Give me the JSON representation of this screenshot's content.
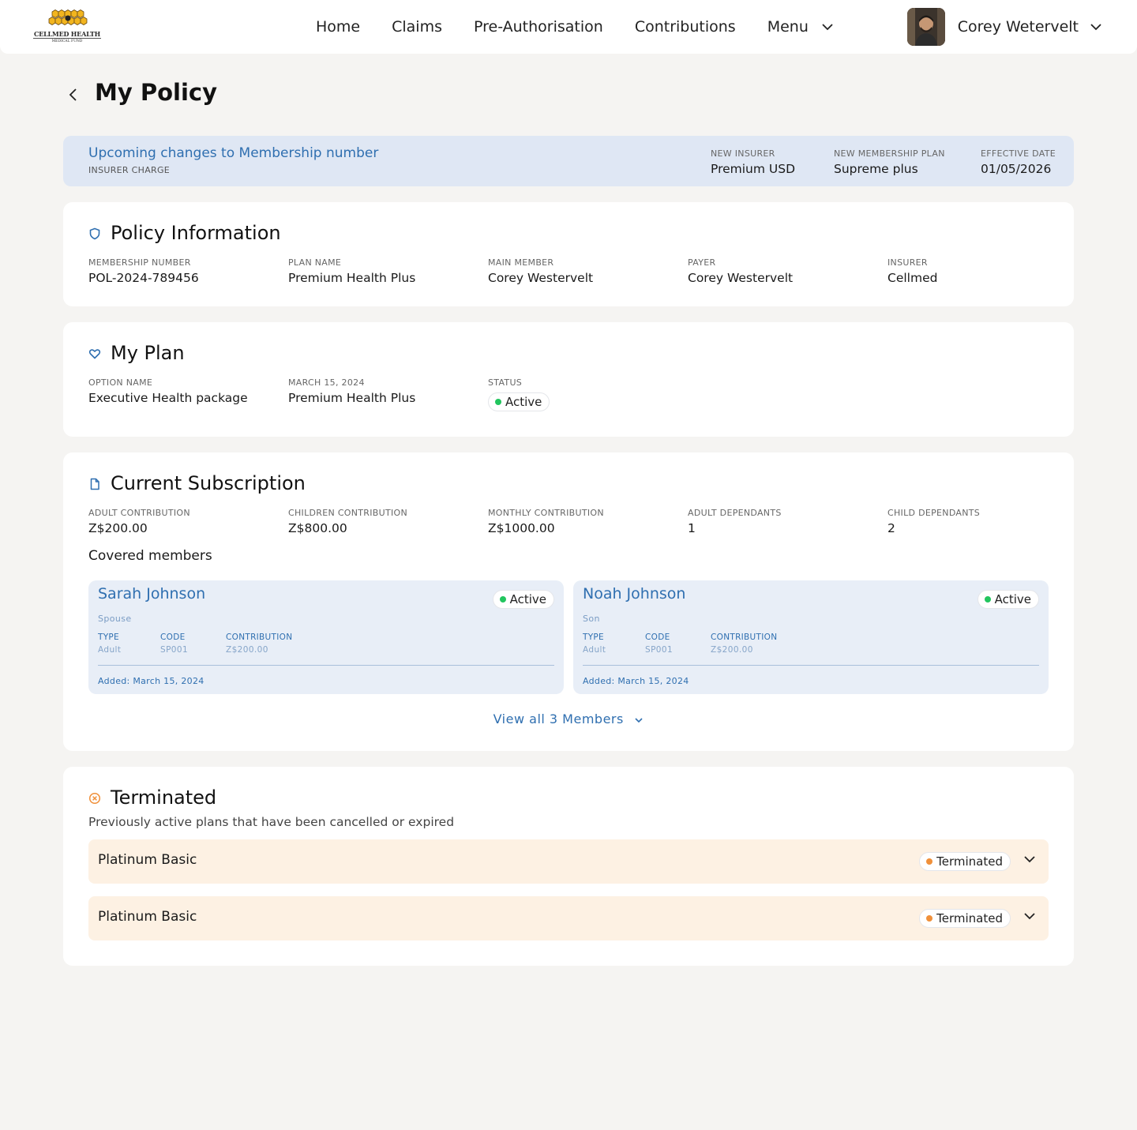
{
  "header": {
    "logo_text": "CELLMED HEALTH",
    "logo_sub": "MEDICAL FUND",
    "nav": [
      "Home",
      "Claims",
      "Pre-Authorisation",
      "Contributions",
      "Menu"
    ],
    "user_name": "Corey Wetervelt"
  },
  "page": {
    "title": "My Policy"
  },
  "banner": {
    "title": "Upcoming changes to Membership number",
    "subtitle": "INSURER CHARGE",
    "fields": [
      {
        "label": "NEW INSURER",
        "value": "Premium USD"
      },
      {
        "label": "NEW MEMBERSHIP PLAN",
        "value": "Supreme plus"
      },
      {
        "label": "EFFECTIVE DATE",
        "value": "01/05/2026"
      }
    ]
  },
  "policy_info": {
    "title": "Policy Information",
    "fields": [
      {
        "label": "MEMBERSHIP NUMBER",
        "value": "POL-2024-789456"
      },
      {
        "label": "PLAN NAME",
        "value": "Premium Health Plus"
      },
      {
        "label": "MAIN MEMBER",
        "value": "Corey Westervelt"
      },
      {
        "label": "PAYER",
        "value": "Corey Westervelt"
      },
      {
        "label": "INSURER",
        "value": "Cellmed"
      }
    ]
  },
  "my_plan": {
    "title": "My Plan",
    "fields": [
      {
        "label": "OPTION NAME",
        "value": "Executive Health package"
      },
      {
        "label": "MARCH 15, 2024",
        "value": "Premium Health Plus"
      }
    ],
    "status_label": "STATUS",
    "status": "Active"
  },
  "subscription": {
    "title": "Current Subscription",
    "fields": [
      {
        "label": "ADULT CONTRIBUTION",
        "value": "Z$200.00"
      },
      {
        "label": "CHILDREN CONTRIBUTION",
        "value": "Z$800.00"
      },
      {
        "label": "MONTHLY CONTRIBUTION",
        "value": "Z$1000.00"
      },
      {
        "label": "ADULT DEPENDANTS",
        "value": "1"
      },
      {
        "label": "CHILD DEPENDANTS",
        "value": "2"
      }
    ],
    "covered_title": "Covered members",
    "members": [
      {
        "name": "Sarah Johnson",
        "relation": "Spouse",
        "status": "Active",
        "type_label": "TYPE",
        "type": "Adult",
        "code_label": "CODE",
        "code": "SP001",
        "contribution_label": "CONTRIBUTION",
        "contribution": "Z$200.00",
        "added": "Added: March 15, 2024"
      },
      {
        "name": "Noah Johnson",
        "relation": "Son",
        "status": "Active",
        "type_label": "TYPE",
        "type": "Adult",
        "code_label": "CODE",
        "code": "SP001",
        "contribution_label": "CONTRIBUTION",
        "contribution": "Z$200.00",
        "added": "Added: March 15, 2024"
      }
    ],
    "view_all": "View all 3 Members"
  },
  "terminated": {
    "title": "Terminated",
    "subtitle": "Previously active plans that have been cancelled or expired",
    "items": [
      {
        "name": "Platinum Basic",
        "status": "Terminated"
      },
      {
        "name": "Platinum Basic",
        "status": "Terminated"
      }
    ]
  },
  "colors": {
    "accent": "#2f6fb0",
    "active_dot": "#22c55e",
    "terminated_dot": "#f0903a",
    "banner_bg": "#dfe7f4",
    "terminated_bg": "#fdf1e3"
  },
  "icons": {
    "back": "chevron-left-icon",
    "policy": "shield-icon",
    "plan": "heart-icon",
    "subscription": "document-icon",
    "terminated": "x-circle-icon",
    "dropdown": "chevron-down-icon"
  }
}
